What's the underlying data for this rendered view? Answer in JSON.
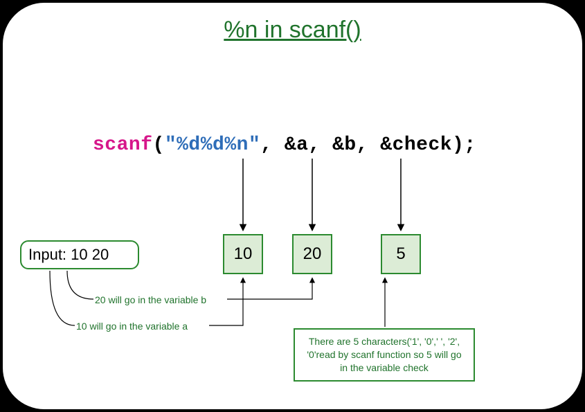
{
  "title": "%n in scanf()",
  "code": {
    "fn": "scanf",
    "open": "(",
    "str": "\"%d%d%n\"",
    "rest": ", &a, &b, &check);"
  },
  "input_label": "Input: 10 20",
  "values": {
    "a": "10",
    "b": "20",
    "check": "5"
  },
  "annotations": {
    "b": "20 will go in the variable b",
    "a": "10 will go in the variable a"
  },
  "explanation": "There are 5 characters('1', '0',' ', '2', '0'read by scanf function so 5 will go in the variable check"
}
